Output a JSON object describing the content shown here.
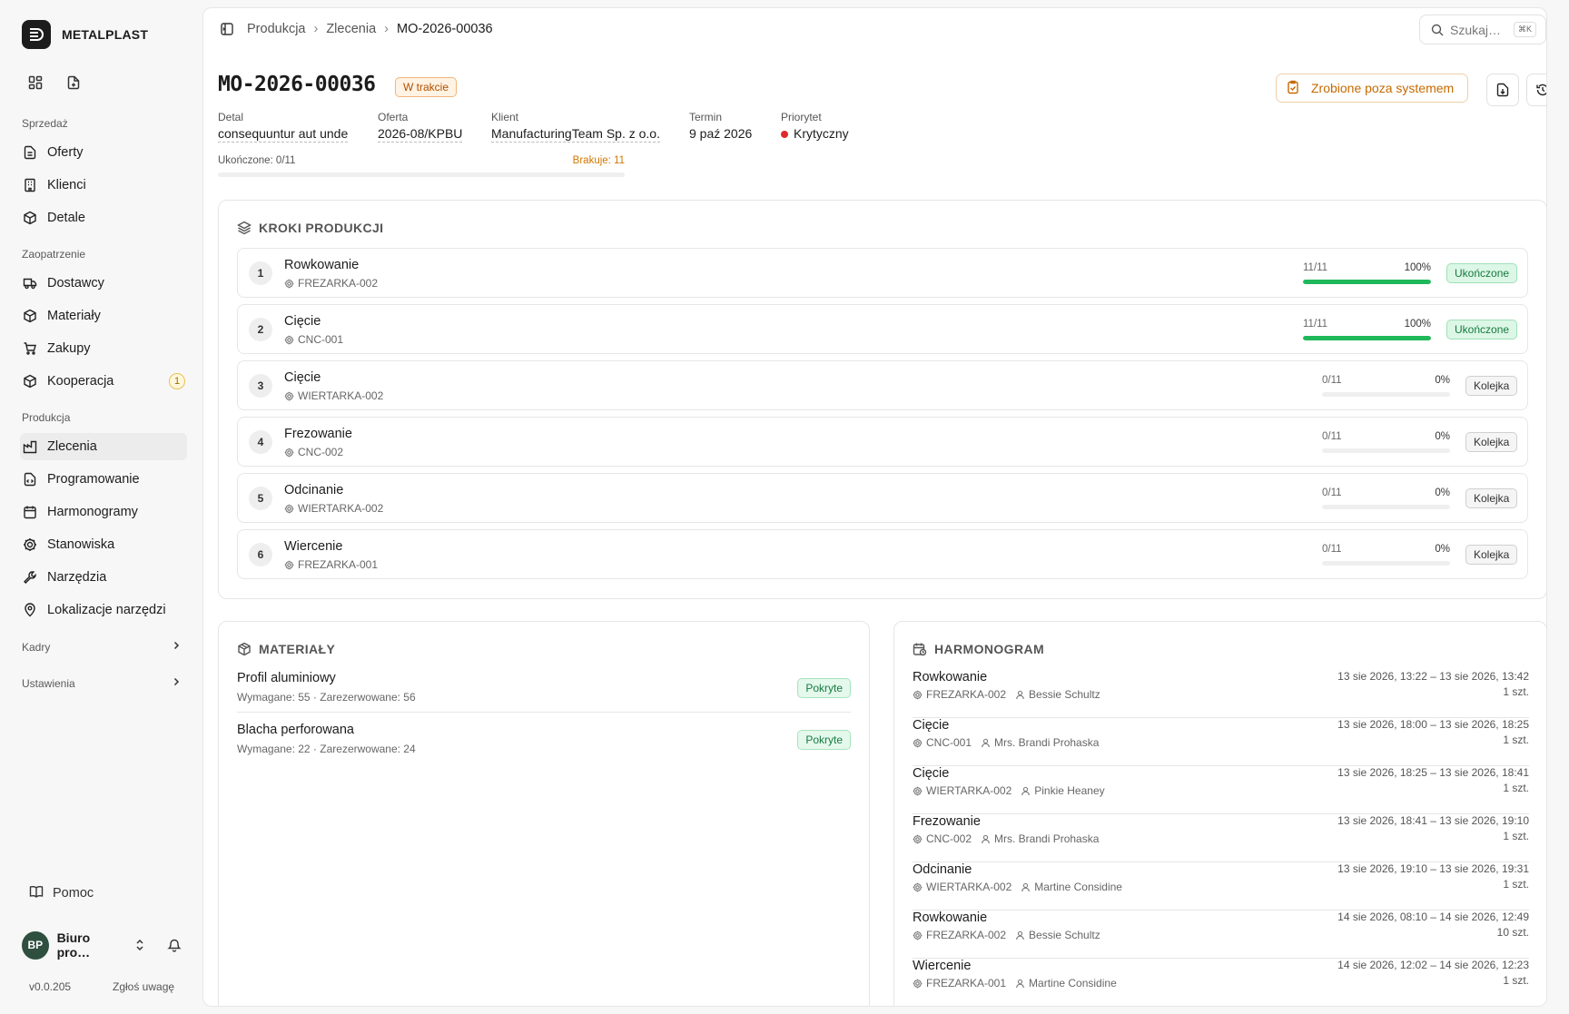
{
  "brand": {
    "name": "METALPLAST"
  },
  "sidebar": {
    "sections": {
      "sales": "Sprzedaż",
      "supply": "Zaopatrzenie",
      "production": "Produkcja"
    },
    "items": [
      {
        "label": "Oferty",
        "icon": "document-icon"
      },
      {
        "label": "Klienci",
        "icon": "building-icon"
      },
      {
        "label": "Detale",
        "icon": "cube-icon"
      },
      {
        "label": "Dostawcy",
        "icon": "truck-icon"
      },
      {
        "label": "Materiały",
        "icon": "cube-icon"
      },
      {
        "label": "Zakupy",
        "icon": "cart-icon"
      },
      {
        "label": "Kooperacja",
        "icon": "cube-icon",
        "badge": "1"
      },
      {
        "label": "Zlecenia",
        "icon": "factory-icon",
        "active": true
      },
      {
        "label": "Programowanie",
        "icon": "file-code-icon"
      },
      {
        "label": "Harmonogramy",
        "icon": "calendar-icon"
      },
      {
        "label": "Stanowiska",
        "icon": "cog-icon"
      },
      {
        "label": "Narzędzia",
        "icon": "wrench-icon"
      },
      {
        "label": "Lokalizacje narzędzi",
        "icon": "map-pin-icon"
      }
    ],
    "groups": {
      "hr": "Kadry",
      "settings": "Ustawienia"
    },
    "help": "Pomoc",
    "user": {
      "initials": "BP",
      "name": "Biuro pro…"
    },
    "version": "v0.0.205",
    "feedback": "Zgłoś uwagę"
  },
  "breadcrumb": [
    "Produkcja",
    "Zlecenia",
    "MO-2026-00036"
  ],
  "search": {
    "placeholder": "Szukaj…",
    "shortcut": "⌘K"
  },
  "order": {
    "title": "MO-2026-00036",
    "status": "W trakcie",
    "outside_button": "Zrobione poza systemem",
    "fields": [
      {
        "label": "Detal",
        "value": "consequuntur aut unde"
      },
      {
        "label": "Oferta",
        "value": "2026-08/KPBU"
      },
      {
        "label": "Klient",
        "value": "ManufacturingTeam Sp. z o.o."
      },
      {
        "label": "Termin",
        "value": "9 paź 2026"
      },
      {
        "label": "Priorytet",
        "value": "Krytyczny"
      }
    ],
    "completed": "Ukończone: 0/11",
    "missing": "Brakuje: 11",
    "progress": 0
  },
  "steps_card": {
    "title": "KROKI PRODUKCJI",
    "steps": [
      {
        "num": "1",
        "name": "Rowkowanie",
        "machine": "FREZARKA-002",
        "count": "11/11",
        "pct": "100%",
        "progress": 1.0,
        "status": "Ukończone"
      },
      {
        "num": "2",
        "name": "Cięcie",
        "machine": "CNC-001",
        "count": "11/11",
        "pct": "100%",
        "progress": 1.0,
        "status": "Ukończone"
      },
      {
        "num": "3",
        "name": "Cięcie",
        "machine": "WIERTARKA-002",
        "count": "0/11",
        "pct": "0%",
        "progress": 0,
        "status": "Kolejka"
      },
      {
        "num": "4",
        "name": "Frezowanie",
        "machine": "CNC-002",
        "count": "0/11",
        "pct": "0%",
        "progress": 0,
        "status": "Kolejka"
      },
      {
        "num": "5",
        "name": "Odcinanie",
        "machine": "WIERTARKA-002",
        "count": "0/11",
        "pct": "0%",
        "progress": 0,
        "status": "Kolejka"
      },
      {
        "num": "6",
        "name": "Wiercenie",
        "machine": "FREZARKA-001",
        "count": "0/11",
        "pct": "0%",
        "progress": 0,
        "status": "Kolejka"
      }
    ]
  },
  "materials_card": {
    "title": "MATERIAŁY",
    "items": [
      {
        "name": "Profil aluminiowy",
        "detail": "Wymagane: 55 · Zarezerwowane: 56",
        "status": "Pokryte"
      },
      {
        "name": "Blacha perforowana",
        "detail": "Wymagane: 22 · Zarezerwowane: 24",
        "status": "Pokryte"
      }
    ]
  },
  "schedule_card": {
    "title": "HARMONOGRAM",
    "items": [
      {
        "name": "Rowkowanie",
        "machine": "FREZARKA-002",
        "person": "Bessie Schultz",
        "time": "13 sie 2026, 13:22 – 13 sie 2026, 13:42",
        "qty": "1 szt."
      },
      {
        "name": "Cięcie",
        "machine": "CNC-001",
        "person": "Mrs. Brandi Prohaska",
        "time": "13 sie 2026, 18:00 – 13 sie 2026, 18:25",
        "qty": "1 szt."
      },
      {
        "name": "Cięcie",
        "machine": "WIERTARKA-002",
        "person": "Pinkie Heaney",
        "time": "13 sie 2026, 18:25 – 13 sie 2026, 18:41",
        "qty": "1 szt."
      },
      {
        "name": "Frezowanie",
        "machine": "CNC-002",
        "person": "Mrs. Brandi Prohaska",
        "time": "13 sie 2026, 18:41 – 13 sie 2026, 19:10",
        "qty": "1 szt."
      },
      {
        "name": "Odcinanie",
        "machine": "WIERTARKA-002",
        "person": "Martine Considine",
        "time": "13 sie 2026, 19:10 – 13 sie 2026, 19:31",
        "qty": "1 szt."
      },
      {
        "name": "Rowkowanie",
        "machine": "FREZARKA-002",
        "person": "Bessie Schultz",
        "time": "14 sie 2026, 08:10 – 14 sie 2026, 12:49",
        "qty": "10 szt."
      },
      {
        "name": "Wiercenie",
        "machine": "FREZARKA-001",
        "person": "Martine Considine",
        "time": "14 sie 2026, 12:02 – 14 sie 2026, 12:23",
        "qty": "1 szt."
      }
    ]
  },
  "colors": {
    "accent_orange": "#c56a00",
    "success_green": "#1fb85a",
    "danger_red": "#e02a2a"
  }
}
